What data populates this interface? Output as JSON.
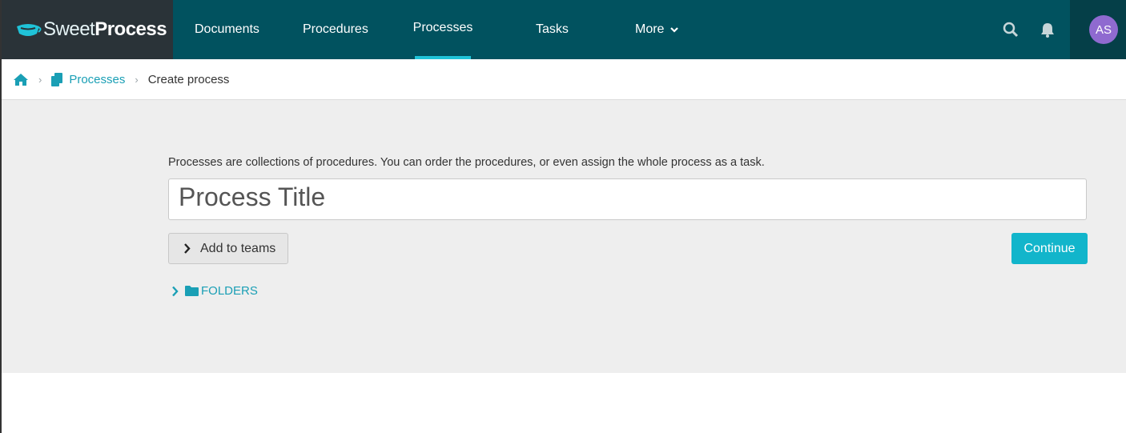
{
  "brand": {
    "sweet": "Sweet",
    "process": "Process"
  },
  "nav": {
    "items": [
      {
        "label": "Documents"
      },
      {
        "label": "Procedures"
      },
      {
        "label": "Processes",
        "active": true
      },
      {
        "label": "Tasks"
      },
      {
        "label": "More"
      }
    ]
  },
  "user": {
    "initials": "AS"
  },
  "breadcrumb": {
    "processes": "Processes",
    "current": "Create process"
  },
  "form": {
    "intro": "Processes are collections of procedures. You can order the procedures, or even assign the whole process as a task.",
    "title_placeholder": "Process Title",
    "add_to_teams": "Add to teams",
    "continue": "Continue",
    "folders": "FOLDERS"
  },
  "colors": {
    "nav_bg": "#01525f",
    "brand_bg": "#2a3338",
    "accent": "#12b5cb",
    "link": "#1a9fb5",
    "avatar": "#8f6ad0"
  },
  "icons": [
    "cup-logo-icon",
    "chevron-down-icon",
    "search-icon",
    "bell-icon",
    "home-icon",
    "chevron-right-icon",
    "copy-icon",
    "folder-icon"
  ]
}
